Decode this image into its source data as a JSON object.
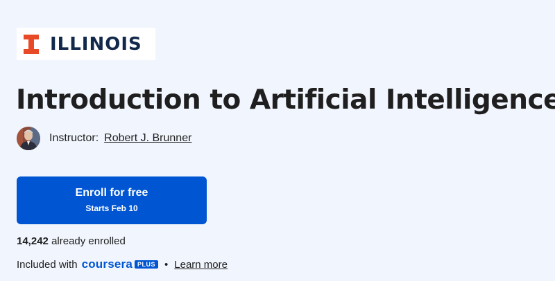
{
  "brand": {
    "logo_text": "ILLINOIS",
    "logo_color": "#13294b",
    "logo_mark_color": "#e84a27"
  },
  "course": {
    "title": "Introduction to Artificial Intelligence"
  },
  "instructor": {
    "label": "Instructor:",
    "name": "Robert J. Brunner"
  },
  "enroll_button": {
    "label": "Enroll for free",
    "sublabel": "Starts Feb 10",
    "color": "#0056d2"
  },
  "enrollment": {
    "count": "14,242",
    "suffix": "already enrolled"
  },
  "included": {
    "prefix": "Included with",
    "brand_word": "coursera",
    "badge": "PLUS",
    "separator": "•",
    "link_text": "Learn more"
  },
  "colors": {
    "background": "#f1f5fd",
    "accent": "#0056d2",
    "text": "#1f1f1f"
  }
}
